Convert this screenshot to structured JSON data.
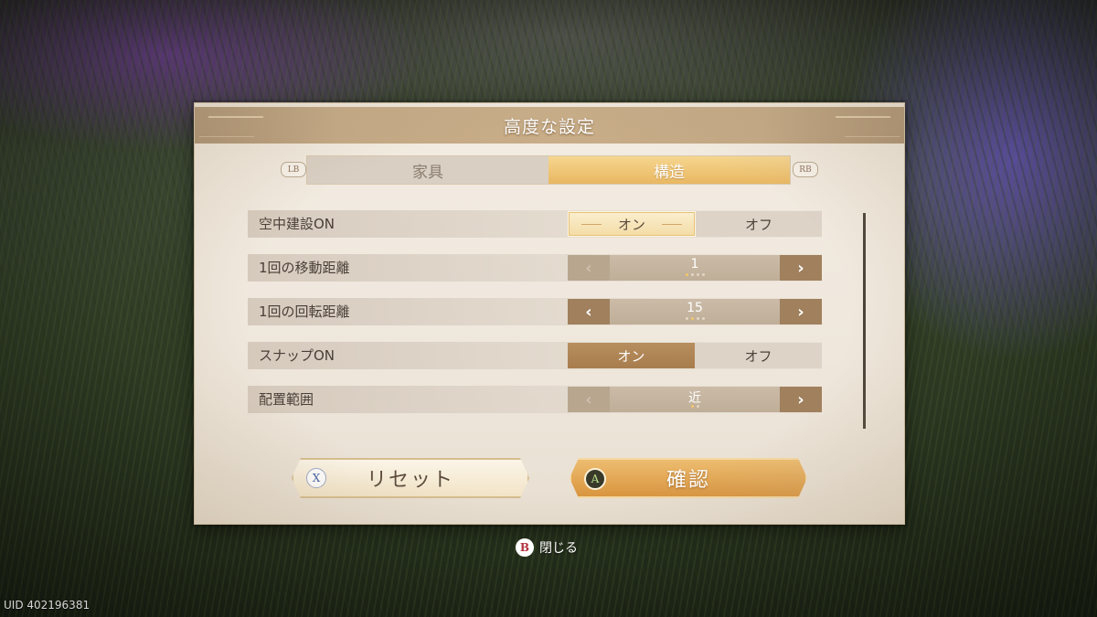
{
  "dialog": {
    "title": "高度な設定",
    "tabs": [
      {
        "label": "家具",
        "active": false
      },
      {
        "label": "構造",
        "active": true
      }
    ],
    "bumper_left": "LB",
    "bumper_right": "RB"
  },
  "settings": [
    {
      "label": "空中建設ON",
      "type": "toggle",
      "on_label": "オン",
      "off_label": "オフ",
      "selected": "on"
    },
    {
      "label": "1回の移動距離",
      "type": "stepper",
      "value": "1",
      "left_enabled": false,
      "right_enabled": true,
      "dots_total": 4,
      "dot_index": 0
    },
    {
      "label": "1回の回転距離",
      "type": "stepper",
      "value": "15",
      "left_enabled": true,
      "right_enabled": true,
      "dots_total": 4,
      "dot_index": 1
    },
    {
      "label": "スナップON",
      "type": "toggle",
      "on_label": "オン",
      "off_label": "オフ",
      "selected": "on"
    },
    {
      "label": "配置範囲",
      "type": "stepper",
      "value": "近",
      "left_enabled": false,
      "right_enabled": true,
      "dots_total": 2,
      "dot_index": 0
    }
  ],
  "actions": {
    "reset": {
      "label": "リセット",
      "button_glyph": "X"
    },
    "confirm": {
      "label": "確認",
      "button_glyph": "A"
    }
  },
  "footer": {
    "close_glyph": "B",
    "close_label": "閉じる",
    "uid": "UID 402196381"
  },
  "icons": {
    "step_left": "‹",
    "step_right": "›"
  },
  "colors": {
    "accent_gold": "#e9b862",
    "step_brown": "#a0805d",
    "confirm_orange": "#d9953e"
  }
}
